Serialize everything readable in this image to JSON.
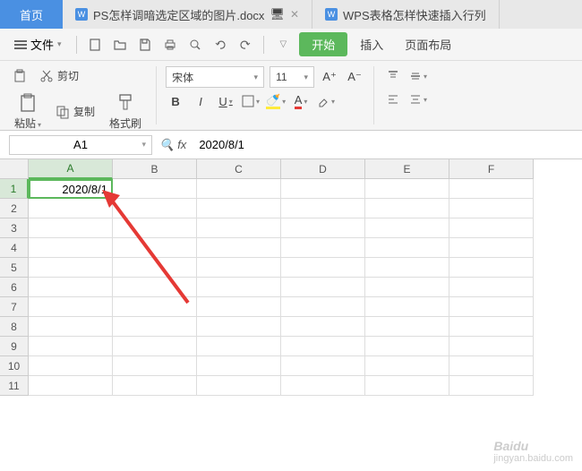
{
  "tabs": {
    "home": "首页",
    "doc1": "PS怎样调暗选定区域的图片.docx",
    "doc2": "WPS表格怎样快速插入行列"
  },
  "menu": {
    "file": "文件",
    "start": "开始",
    "insert": "插入",
    "layout": "页面布局"
  },
  "clipboard": {
    "cut": "剪切",
    "copy": "复制",
    "paste": "粘贴",
    "painter": "格式刷"
  },
  "font": {
    "name": "宋体",
    "size": "11",
    "increase": "A⁺",
    "decrease": "A⁻",
    "bold": "B",
    "italic": "I",
    "underline": "U",
    "fillLabel": "A",
    "colorLabel": "A"
  },
  "namebox": "A1",
  "fxlabel": "fx",
  "formula": "2020/8/1",
  "columns": [
    "A",
    "B",
    "C",
    "D",
    "E",
    "F"
  ],
  "rows": [
    "1",
    "2",
    "3",
    "4",
    "5",
    "6",
    "7",
    "8",
    "9",
    "10",
    "11"
  ],
  "cells": {
    "A1": "2020/8/1"
  },
  "watermark_site": "Baidu",
  "watermark_url": "jingyan.baidu.com"
}
